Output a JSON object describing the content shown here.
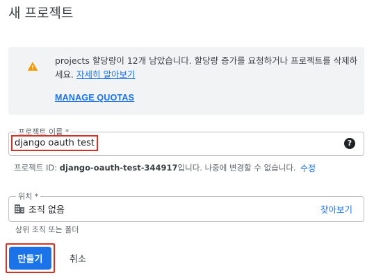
{
  "page": {
    "title": "새 프로젝트"
  },
  "alert": {
    "message_prefix": "projects 할당량이 12개 남았습니다. 할당량 증가를 요청하거나 프로젝트를 삭제하세요.",
    "learn_more": "자세히 알아보기",
    "manage_quotas": "MANAGE QUOTAS",
    "icon": "warning-icon",
    "icon_color": "#f29900"
  },
  "project_name": {
    "label": "프로젝트 이름 *",
    "value": "django oauth test",
    "help_icon": "help-icon"
  },
  "project_id": {
    "prefix": "프로젝트 ID: ",
    "id": "django-oauth-test-344917",
    "suffix": "입니다. 나중에 변경할 수 없습니다.",
    "edit": "수정"
  },
  "location": {
    "label": "위치 *",
    "value": "조직 없음",
    "browse": "찾아보기",
    "hint": "상위 조직 또는 폴더",
    "icon": "building-icon"
  },
  "actions": {
    "create": "만들기",
    "cancel": "취소"
  },
  "colors": {
    "accent": "#1a73e8",
    "highlight_border": "#d93025",
    "alert_bg": "#f1f3f4"
  }
}
